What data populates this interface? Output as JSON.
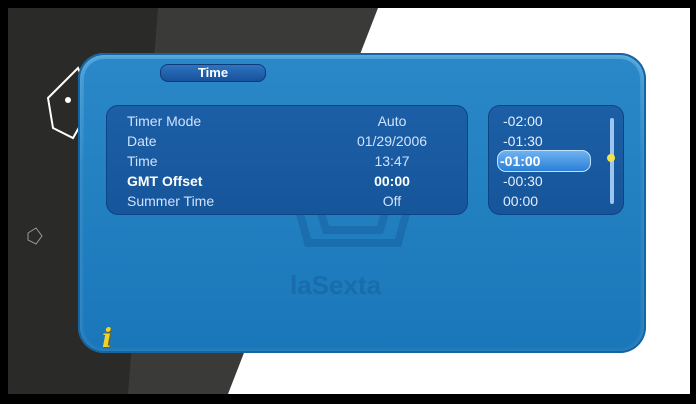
{
  "window": {
    "title": "Time"
  },
  "settings": {
    "rows": [
      {
        "label": "Timer Mode",
        "value": "Auto"
      },
      {
        "label": "Date",
        "value": "01/29/2006"
      },
      {
        "label": "Time",
        "value": "13:47"
      },
      {
        "label": "GMT Offset",
        "value": "00:00"
      },
      {
        "label": "Summer Time",
        "value": "Off"
      }
    ],
    "active_index": 3
  },
  "offset_list": {
    "options": [
      "-02:00",
      "-01:30",
      "-01:00",
      "-00:30",
      "00:00"
    ],
    "selected_index": 2
  },
  "watermark": {
    "text": "laSexta"
  },
  "icons": {
    "info": "info-icon"
  },
  "colors": {
    "panel": "#1d7fc2",
    "accent": "#f2d22a",
    "selection": "#6fb2f0"
  }
}
